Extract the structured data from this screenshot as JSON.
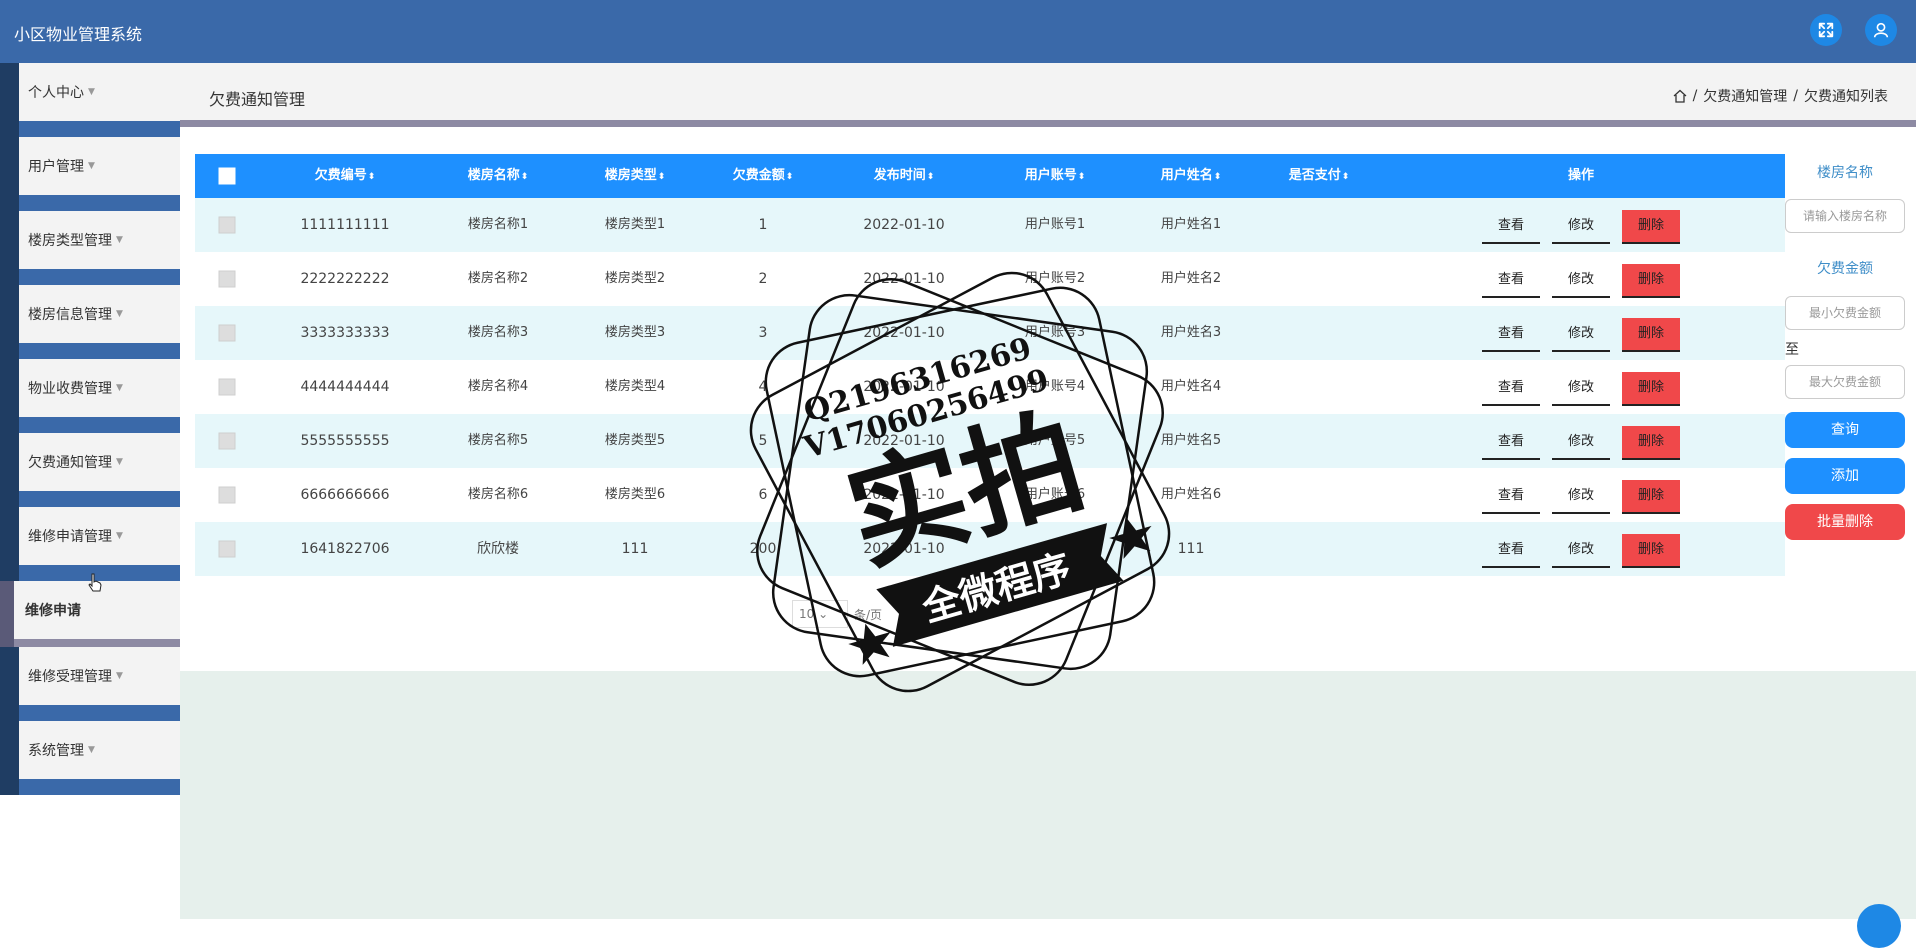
{
  "app": {
    "title": "小区物业管理系统"
  },
  "header": {
    "icons": [
      "fullscreen-icon",
      "user-icon"
    ]
  },
  "sidebar": {
    "items": [
      {
        "label": "个人中心"
      },
      {
        "label": "用户管理"
      },
      {
        "label": "楼房类型管理"
      },
      {
        "label": "楼房信息管理"
      },
      {
        "label": "物业收费管理"
      },
      {
        "label": "欠费通知管理"
      },
      {
        "label": "维修申请管理"
      },
      {
        "label": "维修受理管理"
      },
      {
        "label": "系统管理"
      }
    ],
    "active_sub": {
      "label": "维修申请"
    }
  },
  "page": {
    "heading": "欠费通知管理",
    "breadcrumb": [
      "欠费通知管理",
      "欠费通知列表"
    ],
    "breadcrumb_sep": "/"
  },
  "table": {
    "columns": [
      "欠费编号",
      "楼房名称",
      "楼房类型",
      "欠费金额",
      "发布时间",
      "用户账号",
      "用户姓名",
      "是否支付",
      "操作"
    ],
    "sort_glyph": "⬍",
    "rows": [
      {
        "id": "1111111111",
        "building": "楼房名称1",
        "type": "楼房类型1",
        "amount": "1",
        "date": "2022-01-10",
        "account": "用户账号1",
        "name": "用户姓名1",
        "paid": ""
      },
      {
        "id": "2222222222",
        "building": "楼房名称2",
        "type": "楼房类型2",
        "amount": "2",
        "date": "2022-01-10",
        "account": "用户账号2",
        "name": "用户姓名2",
        "paid": ""
      },
      {
        "id": "3333333333",
        "building": "楼房名称3",
        "type": "楼房类型3",
        "amount": "3",
        "date": "2022-01-10",
        "account": "用户账号3",
        "name": "用户姓名3",
        "paid": ""
      },
      {
        "id": "4444444444",
        "building": "楼房名称4",
        "type": "楼房类型4",
        "amount": "4",
        "date": "2022-01-10",
        "account": "用户账号4",
        "name": "用户姓名4",
        "paid": ""
      },
      {
        "id": "5555555555",
        "building": "楼房名称5",
        "type": "楼房类型5",
        "amount": "5",
        "date": "2022-01-10",
        "account": "用户账号5",
        "name": "用户姓名5",
        "paid": ""
      },
      {
        "id": "6666666666",
        "building": "楼房名称6",
        "type": "楼房类型6",
        "amount": "6",
        "date": "2022-01-10",
        "account": "用户账号6",
        "name": "用户姓名6",
        "paid": ""
      },
      {
        "id": "1641822706",
        "building": "欣欣楼",
        "type": "111",
        "amount": "200",
        "date": "2022-01-10",
        "account": "111",
        "name": "111",
        "paid": ""
      }
    ],
    "actions": {
      "view": "查看",
      "edit": "修改",
      "delete": "删除"
    }
  },
  "pagination": {
    "page_size": "10",
    "page_size_suffix": "条/页"
  },
  "search": {
    "building_label": "楼房名称",
    "building_placeholder": "请输入楼房名称",
    "amount_label": "欠费金额",
    "min_placeholder": "最小欠费金额",
    "to_label": "至",
    "max_placeholder": "最大欠费金额",
    "query_button": "查询",
    "add_button": "添加",
    "batch_delete_button": "批量删除"
  },
  "watermark": {
    "line1": "Q2196316269",
    "line2": "V17060256499",
    "main": "实拍",
    "ribbon": "全微程序"
  },
  "colors": {
    "header": "#3a69a9",
    "table_header": "#1e90ff",
    "row_stripe": "#e6f7fa",
    "delete": "#f0484a",
    "accent_text": "#3f8ec8"
  }
}
